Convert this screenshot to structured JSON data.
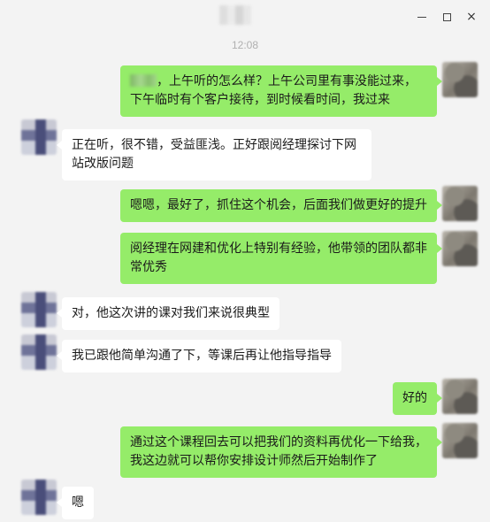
{
  "window": {
    "timestamp": "12:08",
    "controls": {
      "minimize": "minimize",
      "maximize": "maximize",
      "close": "×"
    }
  },
  "messages": [
    {
      "side": "right",
      "text": "，上午听的怎么样？上午公司里有事没能过来，下午临时有个客户接待，到时候看时间，我过来"
    },
    {
      "side": "left",
      "text": "正在听，很不错，受益匪浅。正好跟阅经理探讨下网站改版问题"
    },
    {
      "side": "right",
      "text": "嗯嗯，最好了，抓住这个机会，后面我们做更好的提升"
    },
    {
      "side": "right",
      "text": "阅经理在网建和优化上特别有经验，他带领的团队都非常优秀"
    },
    {
      "side": "left",
      "text": "对，他这次讲的课对我们来说很典型"
    },
    {
      "side": "left",
      "text": "我已跟他简单沟通了下，等课后再让他指导指导"
    },
    {
      "side": "right",
      "text": "好的"
    },
    {
      "side": "right",
      "text": "通过这个课程回去可以把我们的资料再优化一下给我，我这边就可以帮你安排设计师然后开始制作了"
    },
    {
      "side": "left",
      "text": "嗯"
    }
  ],
  "colors": {
    "self_bubble": "#95ec69",
    "other_bubble": "#ffffff",
    "background": "#f3f3f3",
    "timestamp": "#b0b0b0"
  }
}
